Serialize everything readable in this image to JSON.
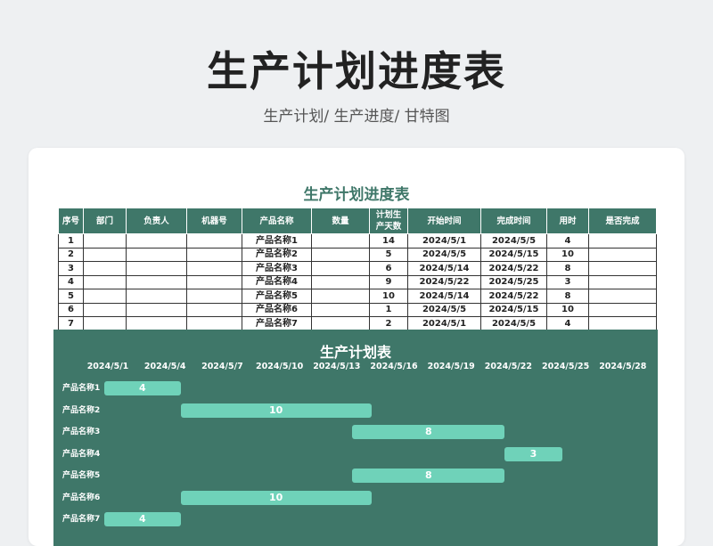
{
  "header": {
    "title": "生产计划进度表",
    "subtitle": "生产计划/  生产进度/  甘特图"
  },
  "sheet": {
    "title": "生产计划进度表",
    "columns": [
      "序号",
      "部门",
      "负责人",
      "机器号",
      "产品名称",
      "数量",
      "计划生产天数",
      "开始时间",
      "完成时间",
      "用时",
      "是否完成"
    ],
    "rows": [
      {
        "seq": "1",
        "dept": "",
        "owner": "",
        "machine": "",
        "product": "产品名称1",
        "qty": "",
        "days": "14",
        "start": "2024/5/1",
        "end": "2024/5/5",
        "used": "4",
        "done": ""
      },
      {
        "seq": "2",
        "dept": "",
        "owner": "",
        "machine": "",
        "product": "产品名称2",
        "qty": "",
        "days": "5",
        "start": "2024/5/5",
        "end": "2024/5/15",
        "used": "10",
        "done": ""
      },
      {
        "seq": "3",
        "dept": "",
        "owner": "",
        "machine": "",
        "product": "产品名称3",
        "qty": "",
        "days": "6",
        "start": "2024/5/14",
        "end": "2024/5/22",
        "used": "8",
        "done": ""
      },
      {
        "seq": "4",
        "dept": "",
        "owner": "",
        "machine": "",
        "product": "产品名称4",
        "qty": "",
        "days": "9",
        "start": "2024/5/22",
        "end": "2024/5/25",
        "used": "3",
        "done": ""
      },
      {
        "seq": "5",
        "dept": "",
        "owner": "",
        "machine": "",
        "product": "产品名称5",
        "qty": "",
        "days": "10",
        "start": "2024/5/14",
        "end": "2024/5/22",
        "used": "8",
        "done": ""
      },
      {
        "seq": "6",
        "dept": "",
        "owner": "",
        "machine": "",
        "product": "产品名称6",
        "qty": "",
        "days": "1",
        "start": "2024/5/5",
        "end": "2024/5/15",
        "used": "10",
        "done": ""
      },
      {
        "seq": "7",
        "dept": "",
        "owner": "",
        "machine": "",
        "product": "产品名称7",
        "qty": "",
        "days": "2",
        "start": "2024/5/1",
        "end": "2024/5/5",
        "used": "4",
        "done": ""
      }
    ]
  },
  "colors": {
    "accent": "#3f7769",
    "bar": "#6fd2b9"
  },
  "chart_data": {
    "type": "bar",
    "title": "生产计划表",
    "x_ticks": [
      "2024/5/1",
      "2024/5/4",
      "2024/5/7",
      "2024/5/10",
      "2024/5/13",
      "2024/5/16",
      "2024/5/19",
      "2024/5/22",
      "2024/5/25",
      "2024/5/28"
    ],
    "xlim": [
      "2024/5/1",
      "2024/5/30"
    ],
    "categories": [
      "产品名称1",
      "产品名称2",
      "产品名称3",
      "产品名称4",
      "产品名称5",
      "产品名称6",
      "产品名称7"
    ],
    "series": [
      {
        "start": [
          "2024/5/1",
          "2024/5/5",
          "2024/5/14",
          "2024/5/22",
          "2024/5/14",
          "2024/5/5",
          "2024/5/1"
        ],
        "values": [
          4,
          10,
          8,
          3,
          8,
          10,
          4
        ]
      }
    ]
  }
}
